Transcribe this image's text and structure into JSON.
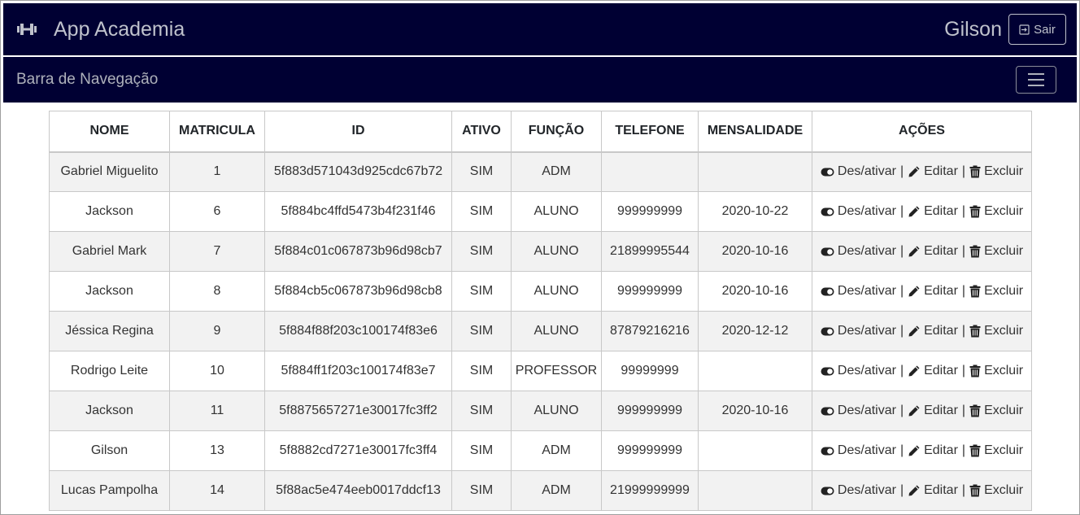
{
  "header": {
    "app_title": "App Academia",
    "user_name": "Gilson",
    "logout_label": "Sair",
    "brand_icon": "dumbbell-icon",
    "logout_icon": "sign-out-icon"
  },
  "nav": {
    "title": "Barra de Navegação",
    "toggle_icon": "hamburger-menu-icon"
  },
  "table": {
    "headers": [
      "NOME",
      "MATRICULA",
      "ID",
      "ATIVO",
      "FUNÇÃO",
      "TELEFONE",
      "MENSALIDADE",
      "AÇÕES"
    ],
    "action_labels": {
      "toggle": "Des/ativar",
      "edit": "Editar",
      "delete": "Excluir",
      "separator": "|"
    },
    "rows": [
      {
        "nome": "Gabriel Miguelito",
        "matricula": "1",
        "id": "5f883d571043d925cdc67b72",
        "ativo": "SIM",
        "funcao": "ADM",
        "telefone": "",
        "mensalidade": ""
      },
      {
        "nome": "Jackson",
        "matricula": "6",
        "id": "5f884bc4ffd5473b4f231f46",
        "ativo": "SIM",
        "funcao": "ALUNO",
        "telefone": "999999999",
        "mensalidade": "2020-10-22"
      },
      {
        "nome": "Gabriel Mark",
        "matricula": "7",
        "id": "5f884c01c067873b96d98cb7",
        "ativo": "SIM",
        "funcao": "ALUNO",
        "telefone": "21899995544",
        "mensalidade": "2020-10-16"
      },
      {
        "nome": "Jackson",
        "matricula": "8",
        "id": "5f884cb5c067873b96d98cb8",
        "ativo": "SIM",
        "funcao": "ALUNO",
        "telefone": "999999999",
        "mensalidade": "2020-10-16"
      },
      {
        "nome": "Jéssica Regina",
        "matricula": "9",
        "id": "5f884f88f203c100174f83e6",
        "ativo": "SIM",
        "funcao": "ALUNO",
        "telefone": "87879216216",
        "mensalidade": "2020-12-12"
      },
      {
        "nome": "Rodrigo Leite",
        "matricula": "10",
        "id": "5f884ff1f203c100174f83e7",
        "ativo": "SIM",
        "funcao": "PROFESSOR",
        "telefone": "99999999",
        "mensalidade": ""
      },
      {
        "nome": "Jackson",
        "matricula": "11",
        "id": "5f8875657271e30017fc3ff2",
        "ativo": "SIM",
        "funcao": "ALUNO",
        "telefone": "999999999",
        "mensalidade": "2020-10-16"
      },
      {
        "nome": "Gilson",
        "matricula": "13",
        "id": "5f8882cd7271e30017fc3ff4",
        "ativo": "SIM",
        "funcao": "ADM",
        "telefone": "999999999",
        "mensalidade": ""
      },
      {
        "nome": "Lucas Pampolha",
        "matricula": "14",
        "id": "5f88ac5e474eeb0017ddcf13",
        "ativo": "SIM",
        "funcao": "ADM",
        "telefone": "21999999999",
        "mensalidade": ""
      }
    ]
  },
  "colors": {
    "header_bg": "#000033",
    "header_text": "#bfc2cc",
    "row_stripe": "#f2f2f2"
  }
}
